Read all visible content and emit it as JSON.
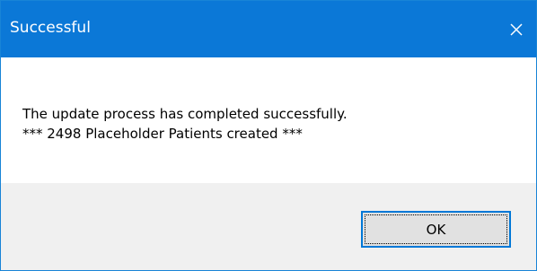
{
  "window": {
    "title": "Successful",
    "close_icon": "close-icon",
    "accent_color": "#0b78d7"
  },
  "message": {
    "line1": "The update process has completed successfully.",
    "line2": "*** 2498 Placeholder Patients created ***"
  },
  "buttons": {
    "ok_label": "OK"
  }
}
